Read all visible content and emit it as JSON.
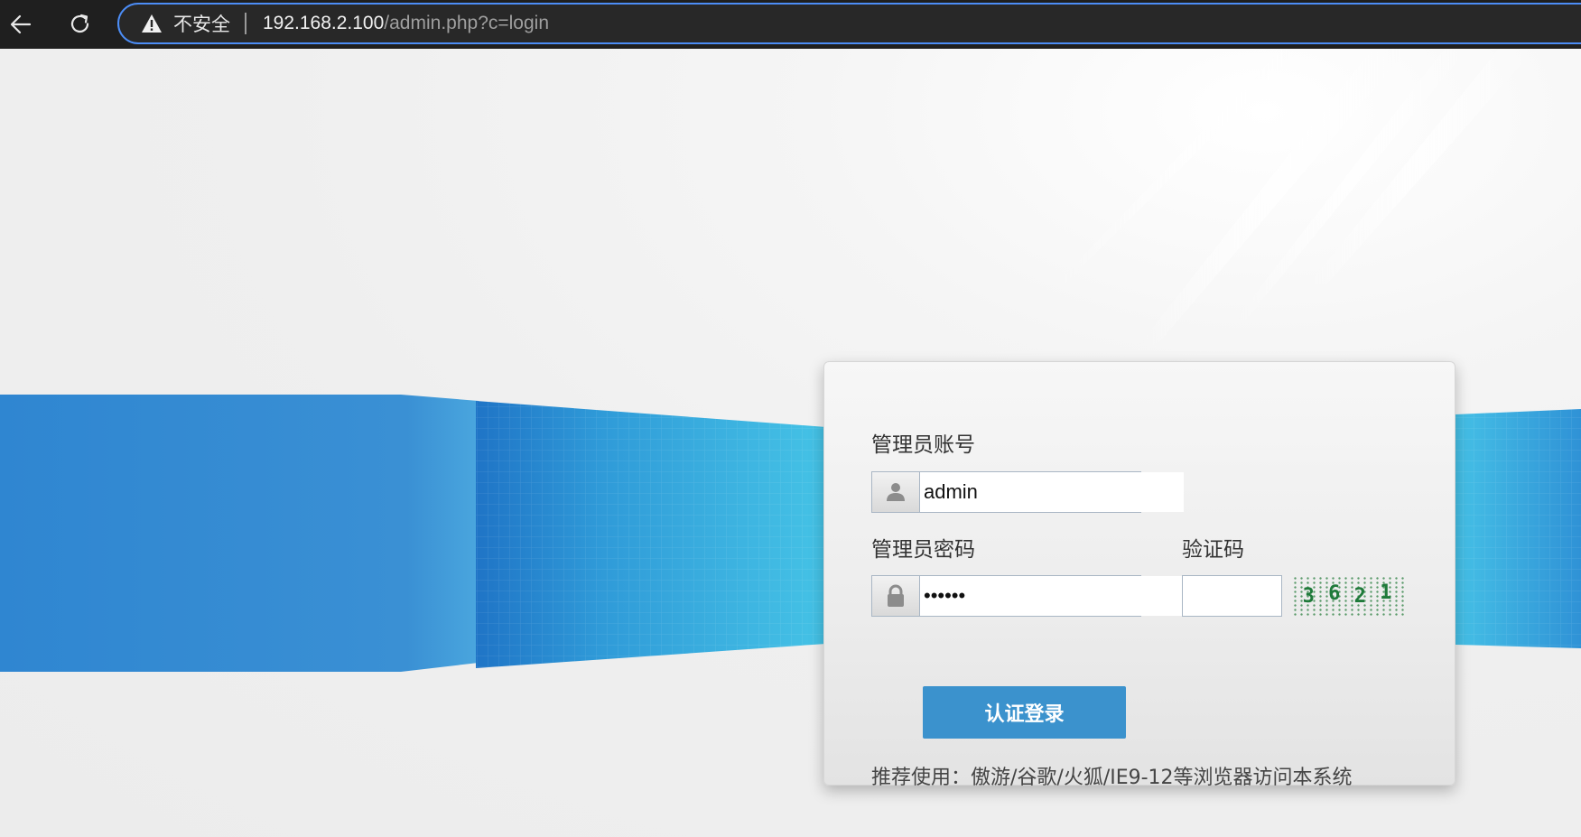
{
  "browser": {
    "security_label": "不安全",
    "url_host": "192.168.2.100",
    "url_path": "/admin.php?c=login"
  },
  "login": {
    "account_label": "管理员账号",
    "account_value": "admin",
    "password_label": "管理员密码",
    "password_value": "••••••",
    "captcha_label": "验证码",
    "captcha_value": "",
    "captcha_chars": [
      "3",
      "6",
      "2",
      "1"
    ],
    "submit_label": "认证登录",
    "browser_hint": "推荐使用：傲游/谷歌/火狐/IE9-12等浏览器访问本系统"
  },
  "icons": {
    "back": "arrow-left-icon",
    "reload": "reload-icon",
    "security": "warning-triangle-icon",
    "account": "user-icon",
    "password": "lock-icon"
  },
  "colors": {
    "accent_blue": "#3b92cd",
    "banner_blue": "#2f86d1",
    "banner_cyan": "#45c3e6",
    "captcha_green": "#1f7a3a",
    "omnibox_border": "#4c8df6"
  }
}
